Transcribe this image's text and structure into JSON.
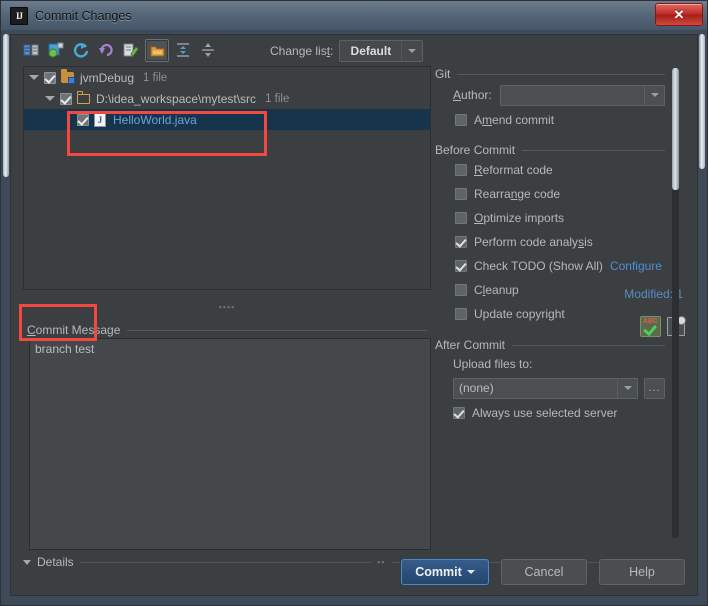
{
  "window": {
    "title": "Commit Changes",
    "logo_text": "IJ",
    "close_label": "✕"
  },
  "toolbar": {
    "buttons": [
      {
        "name": "show-diff-icon",
        "title": "Show Diff"
      },
      {
        "name": "show-diff-preview-icon",
        "title": "Show Diff Preview"
      },
      {
        "name": "refresh-icon",
        "title": "Refresh"
      },
      {
        "name": "rollback-icon",
        "title": "Rollback"
      },
      {
        "name": "edit-source-icon",
        "title": "Edit Source"
      },
      {
        "name": "group-by-directory-icon",
        "title": "Group by Directory"
      },
      {
        "name": "expand-all-icon",
        "title": "Expand All"
      },
      {
        "name": "collapse-all-icon",
        "title": "Collapse All"
      }
    ],
    "changelist_label": "Change list:",
    "changelist_label_mnemonic": "Change lis",
    "changelist_label_underlined": "t",
    "changelist_label_tail": ":",
    "changelist_value": "Default"
  },
  "tree": {
    "rows": [
      {
        "label": "jvmDebug",
        "count": "1 file",
        "checked": true,
        "expanded": true,
        "icon": "modified-folder-icon",
        "depth": 0,
        "selected": false
      },
      {
        "label": "D:\\idea_workspace\\mytest\\src",
        "count": "1 file",
        "checked": true,
        "expanded": true,
        "icon": "folder-icon",
        "depth": 1,
        "selected": false
      },
      {
        "label": "HelloWorld.java",
        "count": "",
        "checked": true,
        "expanded": null,
        "icon": "java-file-icon",
        "depth": 2,
        "selected": true
      }
    ],
    "modified_status": "Modified: 1"
  },
  "commit_message": {
    "label_head": "C",
    "label_tail": "ommit Message",
    "value": "branch test",
    "spellcheck_icon": "spellcheck-icon",
    "history_icon": "commit-message-history-icon"
  },
  "git": {
    "section_title": "Git",
    "author_label_head": "A",
    "author_label_tail": "uthor:",
    "author_value": "",
    "amend_commit": {
      "label_head": "A",
      "label_mnemonic": "m",
      "label_tail": "end commit",
      "checked": false
    }
  },
  "before_commit": {
    "section_title": "Before Commit",
    "items": [
      {
        "pre": "",
        "mn": "R",
        "post": "eformat code",
        "checked": false,
        "name": "reformat-code"
      },
      {
        "pre": "Rearra",
        "mn": "n",
        "post": "ge code",
        "checked": false,
        "name": "rearrange-code"
      },
      {
        "pre": "",
        "mn": "O",
        "post": "ptimize imports",
        "checked": false,
        "name": "optimize-imports"
      },
      {
        "pre": "Perform code analy",
        "mn": "s",
        "post": "is",
        "checked": true,
        "name": "perform-code-analysis"
      },
      {
        "pre": "Check TODO (Show All)",
        "mn": "",
        "post": "",
        "checked": true,
        "name": "check-todo"
      },
      {
        "pre": "C",
        "mn": "l",
        "post": "eanup",
        "checked": false,
        "name": "cleanup"
      },
      {
        "pre": "Update copyright",
        "mn": "",
        "post": "",
        "checked": false,
        "name": "update-copyright"
      }
    ],
    "configure_link": "Configure"
  },
  "after_commit": {
    "section_title": "After Commit",
    "upload_label": "Upload files to:",
    "upload_value": "(none)",
    "browse_label": "...",
    "always_use_selected_server": {
      "label": "Always use selected server",
      "checked": true
    }
  },
  "details": {
    "label": "Details",
    "expanded": true
  },
  "buttons": {
    "commit": "Commit",
    "cancel": "Cancel",
    "help": "Help"
  },
  "annotations": {
    "accent_red": "#f2483f",
    "selection_blue": "#16354d",
    "link_blue": "#4c8ed6"
  }
}
